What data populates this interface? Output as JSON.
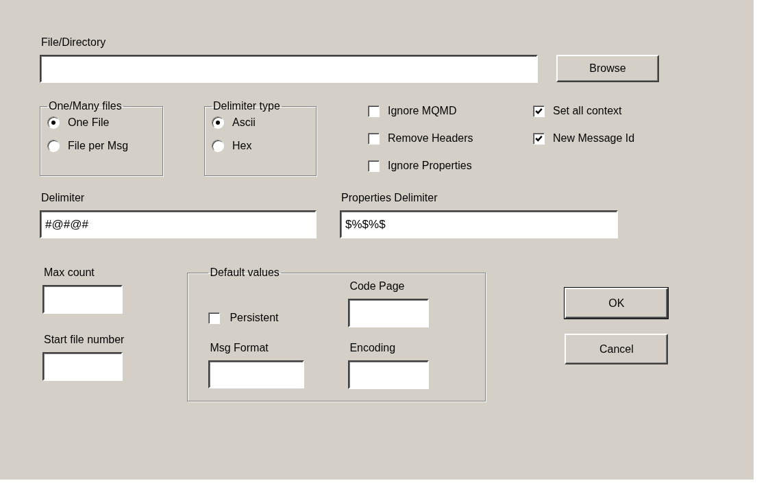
{
  "file_directory": {
    "label": "File/Directory"
  },
  "browse_button": {
    "label": "Browse"
  },
  "one_many_files": {
    "title": "One/Many files",
    "options": [
      {
        "label": "One File",
        "selected": true
      },
      {
        "label": "File per Msg",
        "selected": false
      }
    ]
  },
  "delimiter_type": {
    "title": "Delimiter type",
    "options": [
      {
        "label": "Ascii",
        "selected": true
      },
      {
        "label": "Hex",
        "selected": false
      }
    ]
  },
  "option_columns": [
    [
      {
        "label": "Ignore MQMD",
        "checked": false
      },
      {
        "label": "Remove Headers",
        "checked": false
      },
      {
        "label": "Ignore Properties",
        "checked": false
      }
    ],
    [
      {
        "label": "Set all context",
        "checked": true
      },
      {
        "label": "New Message Id",
        "checked": true
      }
    ]
  ],
  "delimiter": {
    "label": "Delimiter",
    "value": "#@#@#"
  },
  "properties_delimiter": {
    "label": "Properties Delimiter",
    "value": "$%$%$"
  },
  "max_count": {
    "label": "Max count"
  },
  "start_file_number": {
    "label": "Start file number"
  },
  "default_values": {
    "title": "Default values",
    "persistent": {
      "label": "Persistent",
      "checked": false
    },
    "msg_format": {
      "label": "Msg Format"
    },
    "code_page": {
      "label": "Code Page"
    },
    "encoding": {
      "label": "Encoding"
    }
  },
  "buttons": [
    {
      "label": "OK",
      "default": true
    },
    {
      "label": "Cancel",
      "default": false
    }
  ]
}
